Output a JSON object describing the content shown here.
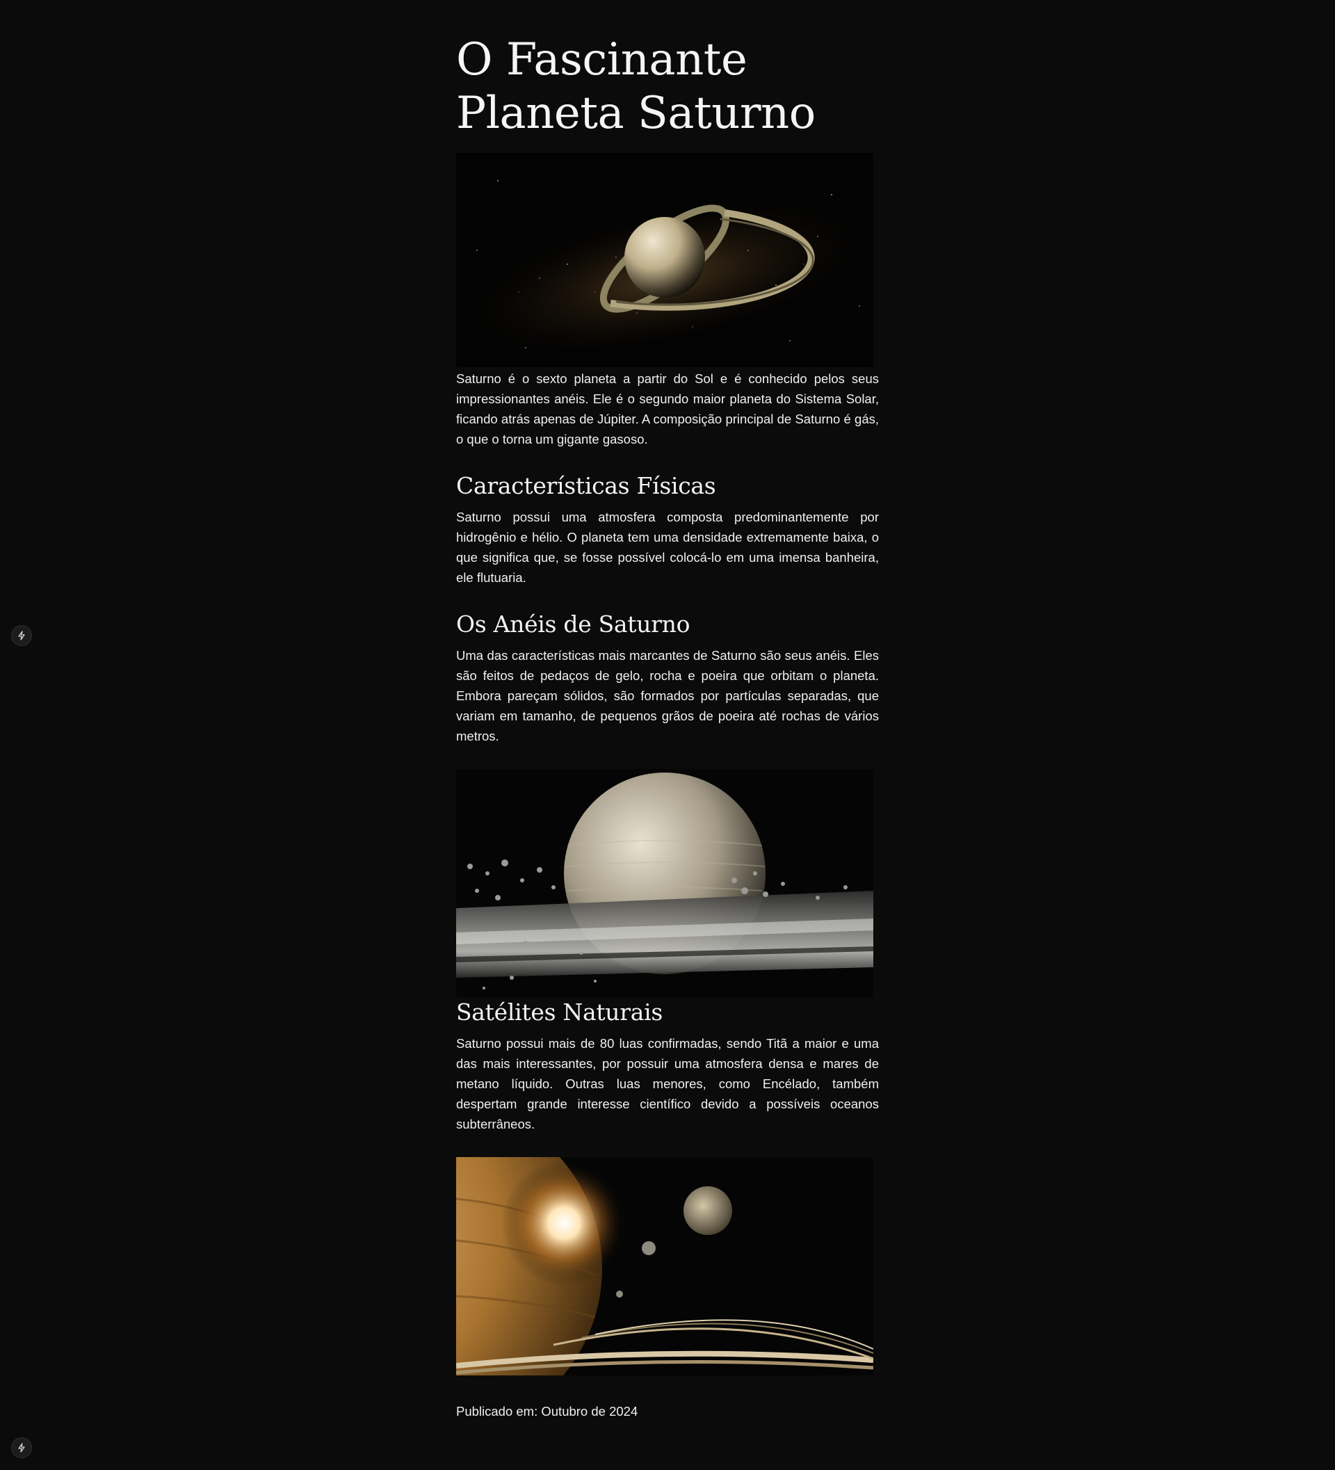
{
  "article": {
    "title": "O Fascinante Planeta Saturno",
    "intro": "Saturno é o sexto planeta a partir do Sol e é conhecido pelos seus impressionantes anéis. Ele é o segundo maior planeta do Sistema Solar, ficando atrás apenas de Júpiter. A composição principal de Saturno é gás, o que o torna um gigante gasoso.",
    "sections": [
      {
        "heading": "Características Físicas",
        "text": "Saturno possui uma atmosfera composta predominantemente por hidrogênio e hélio. O planeta tem uma densidade extremamente baixa, o que significa que, se fosse possível colocá-lo em uma imensa banheira, ele flutuaria."
      },
      {
        "heading": "Os Anéis de Saturno",
        "text": "Uma das características mais marcantes de Saturno são seus anéis. Eles são feitos de pedaços de gelo, rocha e poeira que orbitam o planeta. Embora pareçam sólidos, são formados por partículas separadas, que variam em tamanho, de pequenos grãos de poeira até rochas de vários metros."
      },
      {
        "heading": "Satélites Naturais",
        "text": "Saturno possui mais de 80 luas confirmadas, sendo Titã a maior e uma das mais interessantes, por possuir uma atmosfera densa e mares de metano líquido. Outras luas menores, como Encélado, também despertam grande interesse científico devido a possíveis oceanos subterrâneos."
      }
    ],
    "published": "Publicado em: Outubro de 2024"
  },
  "icons": {
    "floating_button": "lightning-icon"
  },
  "colors": {
    "background": "#0b0b0b",
    "text": "#f0f0f0"
  }
}
